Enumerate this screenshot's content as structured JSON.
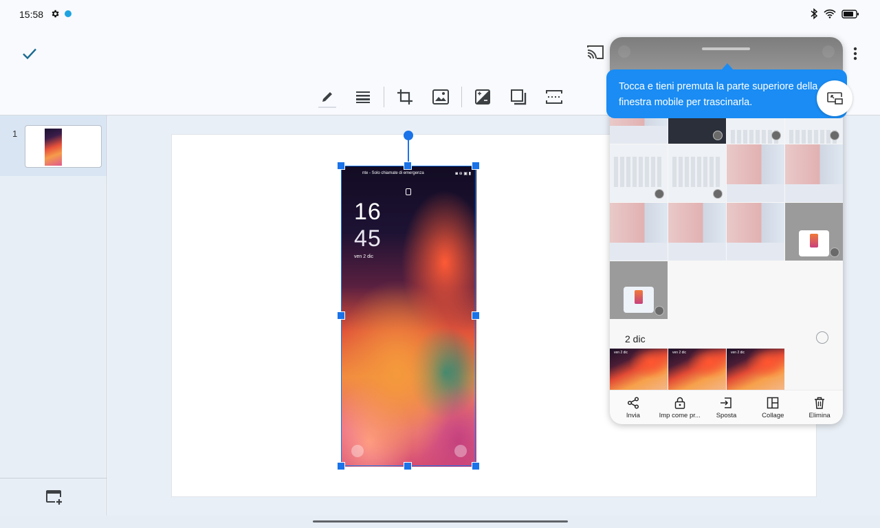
{
  "status_bar": {
    "time": "15:58",
    "icons": [
      "gear-icon",
      "app-notification-icon",
      "bluetooth-icon",
      "wifi-icon",
      "battery-icon"
    ]
  },
  "app_bar": {
    "done_icon": "check-icon",
    "cast_icon": "cast-icon",
    "more_icon": "more-vert-icon"
  },
  "toolbar": {
    "tools": [
      "pen-icon",
      "line-weight-icon",
      "crop-icon",
      "replace-image-icon",
      "adjustments-icon",
      "drop-shadow-icon",
      "alt-text-icon"
    ]
  },
  "slides_panel": {
    "slides": [
      {
        "number": "1"
      }
    ],
    "new_slide_icon": "add-slide-icon"
  },
  "slide_image": {
    "status_text": "nte - Solo chiamate di emergenza",
    "status_icons": "◙ ⊕ ▣ ▮",
    "hour": "16",
    "minute": "45",
    "date": "ven 2 dic"
  },
  "tooltip": {
    "text": "Tocca e tieni premuta la parte superiore della finestra mobile per trascinarla.",
    "icon": "pip-window-icon"
  },
  "gallery": {
    "section_date": "2 dic",
    "photo_date_text": "ven 2 dic",
    "actions": [
      {
        "label": "Invia",
        "icon": "share-icon"
      },
      {
        "label": "Imp come pr...",
        "icon": "lock-icon"
      },
      {
        "label": "Sposta",
        "icon": "move-icon"
      },
      {
        "label": "Collage",
        "icon": "collage-icon"
      },
      {
        "label": "Elimina",
        "icon": "delete-icon"
      }
    ]
  },
  "colors": {
    "accent": "#1a73e8",
    "tooltip_bg": "#1a8cf3",
    "panel_bg": "#e7eef6",
    "selected_slide_bg": "#d9e5f3"
  }
}
